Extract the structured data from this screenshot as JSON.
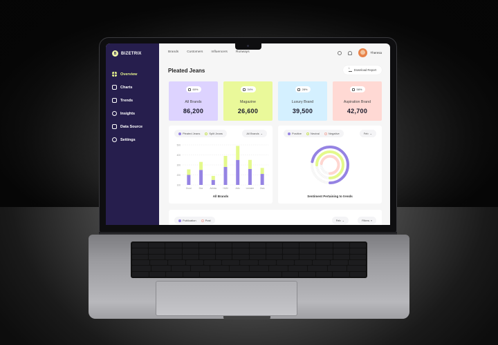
{
  "app": {
    "brand_name": "BIZETRIX",
    "brand_initial": "B"
  },
  "sidebar": {
    "items": [
      {
        "label": "Overview",
        "icon": "grid-icon",
        "active": true
      },
      {
        "label": "Charts",
        "icon": "chart-icon",
        "active": false
      },
      {
        "label": "Trends",
        "icon": "trends-icon",
        "active": false
      },
      {
        "label": "Insights",
        "icon": "insights-icon",
        "active": false
      },
      {
        "label": "Data Source",
        "icon": "database-icon",
        "active": false
      },
      {
        "label": "Settings",
        "icon": "gear-icon",
        "active": false
      }
    ]
  },
  "topnav": {
    "links": [
      "Brands",
      "Customers",
      "Influencers",
      "Runways"
    ],
    "user_name": "Theresa"
  },
  "page": {
    "title": "Pleated Jeans",
    "download_label": "Download Report"
  },
  "cards": [
    {
      "label": "All Brands",
      "value": "86,200",
      "percent": "60%",
      "color": "#ddd3ff"
    },
    {
      "label": "Magazine",
      "value": "26,600",
      "percent": "34%",
      "color": "#eaf99a"
    },
    {
      "label": "Luxury Brand",
      "value": "39,500",
      "percent": "28%",
      "color": "#d4f0ff"
    },
    {
      "label": "Aspiration Brand",
      "value": "42,700",
      "percent": "58%",
      "color": "#ffd9d4"
    }
  ],
  "bar_panel": {
    "legend": [
      "Pleated Jeans",
      "Split Jeans"
    ],
    "filter_label": "All Brands"
  },
  "donut_panel": {
    "legend": [
      "Positive",
      "Neutral",
      "Negative"
    ],
    "filter_label": "Feb"
  },
  "bottom_panel": {
    "legend": [
      "Publication",
      "Post"
    ],
    "month_label": "Feb",
    "filters_label": "Filters"
  },
  "chart_data": [
    {
      "type": "bar",
      "stacked": true,
      "title": "All Brands",
      "categories": [
        "Gucci",
        "Dior",
        "Adidas",
        "H&M",
        "Adio",
        "Lemaire",
        "Zara"
      ],
      "series": [
        {
          "name": "Pleated Jeans",
          "color": "#9583e3",
          "values": [
            100,
            150,
            50,
            180,
            250,
            160,
            110
          ]
        },
        {
          "name": "Split Jeans",
          "color": "#e4f98c",
          "values": [
            55,
            80,
            40,
            110,
            140,
            90,
            60
          ]
        }
      ],
      "yticks": [
        "100",
        "200",
        "300",
        "400",
        "500"
      ],
      "ylim": [
        0,
        400
      ],
      "grid": true
    },
    {
      "type": "pie",
      "subtype": "radial-progress",
      "title": "Sentiment Pertaining to trends",
      "series": [
        {
          "name": "Positive",
          "color": "#9583e3",
          "value": 0.72
        },
        {
          "name": "Neutral",
          "color": "#e4f98c",
          "value": 0.75
        },
        {
          "name": "Negative",
          "color": "#ffd6d0",
          "value": 0.72
        }
      ]
    }
  ],
  "colors": {
    "sidebar_bg": "#261e4d",
    "accent_active": "#e7f58f",
    "purple": "#9583e3",
    "lime": "#e4f98c",
    "pink": "#ffd6d0"
  }
}
